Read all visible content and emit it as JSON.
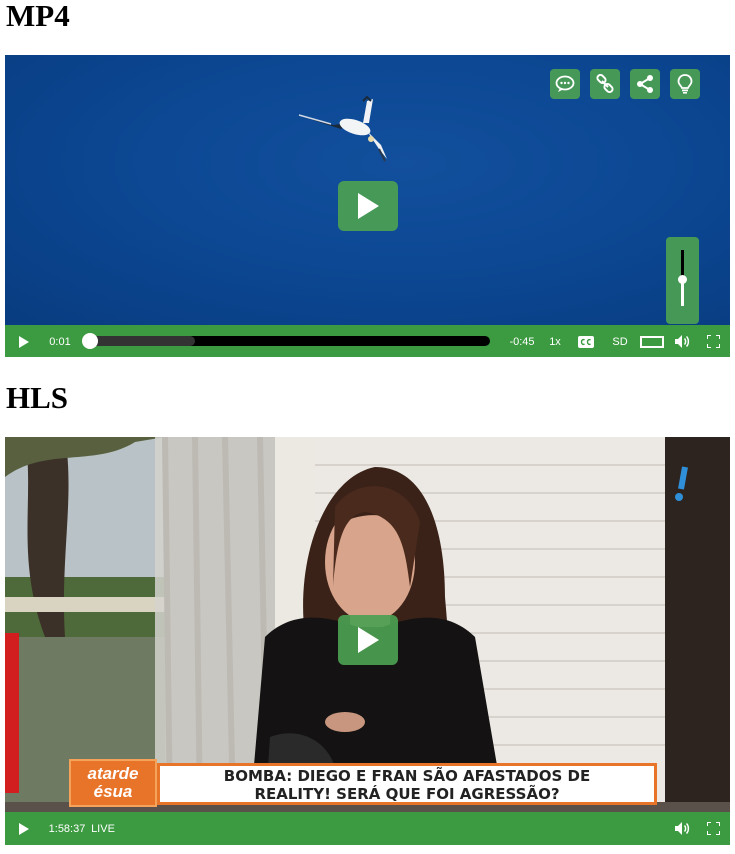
{
  "sections": [
    {
      "heading": "MP4",
      "controls": {
        "current_time": "0:01",
        "remaining_time": "-0:45",
        "speed": "1x",
        "quality": "SD",
        "progress_fraction": 0.02,
        "buffered_fraction": 0.27,
        "volume_fraction": 0.35
      },
      "top_buttons": [
        "comment-icon",
        "link-icon",
        "share-icon",
        "lightbulb-icon"
      ]
    },
    {
      "heading": "HLS",
      "controls": {
        "current_time": "1:58:37",
        "live_label": "LIVE"
      },
      "overlay": {
        "logo_line1": "atarde",
        "logo_line2": "ésua",
        "headline_line1": "BOMBA: DIEGO E FRAN SÃO AFASTADOS DE",
        "headline_line2": "REALITY! SERÁ QUE FOI AGRESSÃO?"
      }
    }
  ],
  "colors": {
    "accent": "#3c9a41",
    "sky": "#0c4894",
    "banner_orange": "#e8742a"
  }
}
